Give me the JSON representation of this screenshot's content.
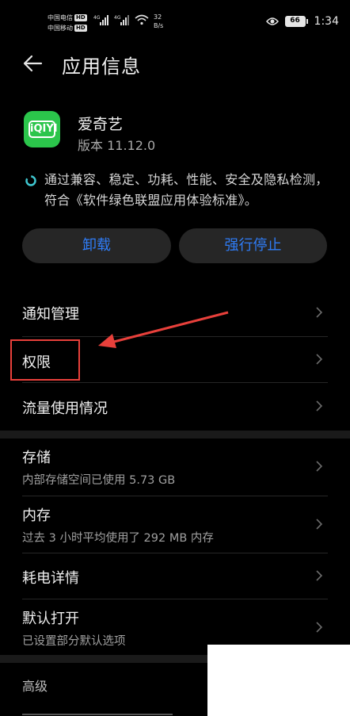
{
  "status_bar": {
    "carrier1": "中国电信",
    "carrier2": "中国移动",
    "hd": "HD",
    "net1": "4G",
    "net2": "4G",
    "speed_value": "32",
    "speed_unit": "B/s",
    "battery": "66",
    "time": "1:34"
  },
  "header": {
    "title": "应用信息"
  },
  "app": {
    "name": "爱奇艺",
    "version": "版本 11.12.0",
    "logo_text": "iQIYI",
    "certification": "通过兼容、稳定、功耗、性能、安全及隐私检测，符合《软件绿色联盟应用体验标准》。"
  },
  "actions": {
    "uninstall": "卸载",
    "force_stop": "强行停止"
  },
  "list": {
    "notifications": "通知管理",
    "permissions": "权限",
    "data_usage": "流量使用情况",
    "storage": "存储",
    "storage_sub": "内部存储空间已使用 5.73 GB",
    "memory": "内存",
    "memory_sub": "过去 3 小时平均使用了 292 MB 内存",
    "power": "耗电详情",
    "default_open": "默认打开",
    "default_open_sub": "已设置部分默认选项",
    "advanced": "高级"
  },
  "colors": {
    "accent": "#2f7cf6",
    "app_icon": "#2bc54b",
    "annotation": "#e8403b",
    "background": "#000000"
  }
}
